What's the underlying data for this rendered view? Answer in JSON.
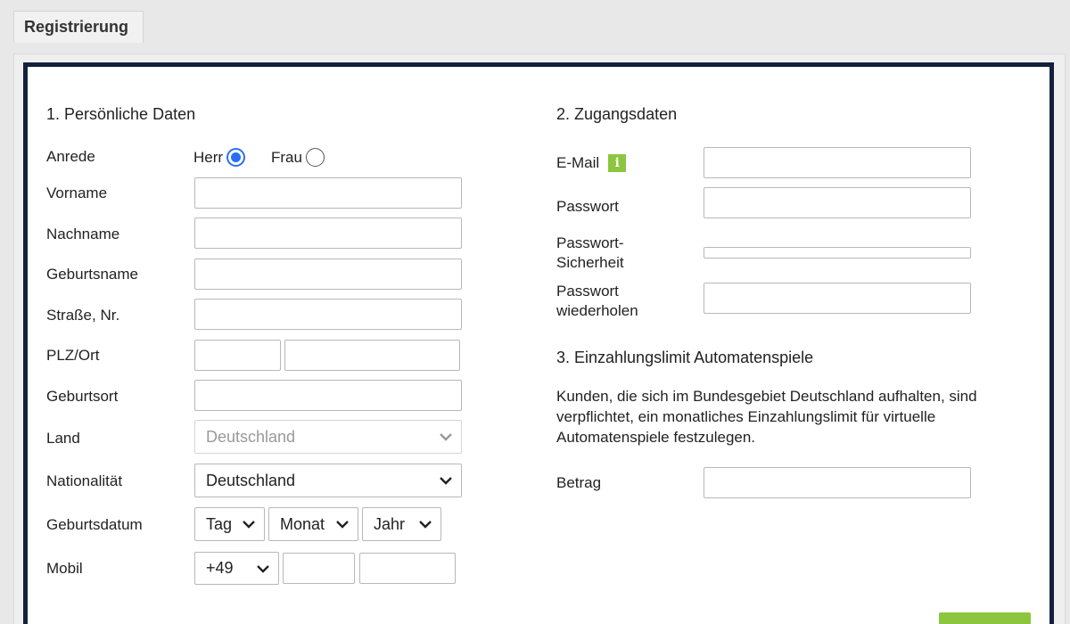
{
  "tab": {
    "label": "Registrierung"
  },
  "personal": {
    "heading": "1. Persönliche Daten",
    "anrede_label": "Anrede",
    "herr_label": "Herr",
    "frau_label": "Frau",
    "anrede_selected": "Herr",
    "vorname_label": "Vorname",
    "nachname_label": "Nachname",
    "geburtsname_label": "Geburtsname",
    "strasse_label": "Straße, Nr.",
    "plz_label": "PLZ/Ort",
    "geburtsort_label": "Geburtsort",
    "land_label": "Land",
    "land_value": "Deutschland",
    "nationalitaet_label": "Nationalität",
    "nationalitaet_value": "Deutschland",
    "geburtsdatum_label": "Geburtsdatum",
    "tag_value": "Tag",
    "monat_value": "Monat",
    "jahr_value": "Jahr",
    "mobil_label": "Mobil",
    "vorwahl_value": "+49"
  },
  "access": {
    "heading": "2. Zugangsdaten",
    "email_label": "E-Mail",
    "info_glyph": "i",
    "passwort_label": "Passwort",
    "sicherheit_label_1": "Passwort-",
    "sicherheit_label_2": "Sicherheit",
    "wiederholen_label_1": "Passwort",
    "wiederholen_label_2": "wiederholen"
  },
  "limit": {
    "heading": "3. Einzahlungslimit Automatenspiele",
    "text_line_1": "Kunden, die sich im Bundesgebiet Deutschland aufhalten, sind",
    "text_line_2": "verpflichtet, ein monatliches Einzahlungslimit für virtuelle",
    "text_line_3": "Automatenspiele festzulegen.",
    "betrag_label": "Betrag"
  },
  "colors": {
    "panel_border": "#14213d",
    "accent_green": "#8cc63f",
    "radio_blue": "#2a6ef5"
  }
}
